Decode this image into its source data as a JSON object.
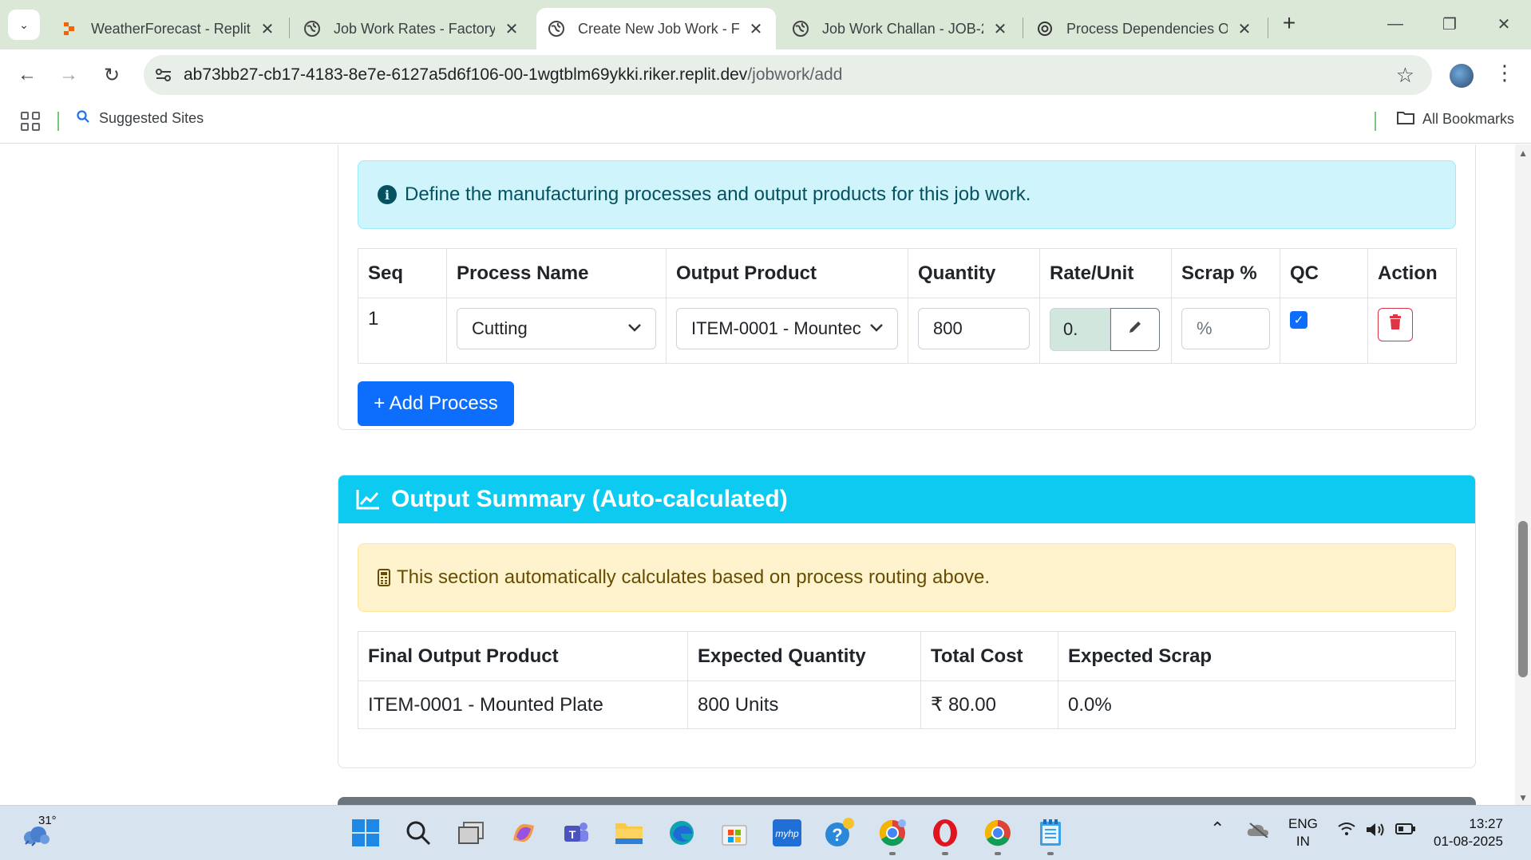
{
  "browser": {
    "tabs": [
      {
        "title": "WeatherForecast - Replit",
        "icon": "replit-icon",
        "active": false
      },
      {
        "title": "Job Work Rates - Factory",
        "icon": "globe-icon",
        "active": false
      },
      {
        "title": "Create New Job Work - F",
        "icon": "globe-icon",
        "active": true
      },
      {
        "title": "Job Work Challan - JOB-2",
        "icon": "globe-icon",
        "active": false
      },
      {
        "title": "Process Dependencies O",
        "icon": "openai-icon",
        "active": false
      }
    ],
    "url_host": "ab73bb27-cb17-4183-8e7e-6127a5d6f106-00-1wgtblm69ykki.riker.replit.dev",
    "url_path": "/jobwork/add",
    "bookmarks": {
      "suggested": "Suggested Sites",
      "all": "All Bookmarks"
    }
  },
  "process_section": {
    "info_text": "Define the manufacturing processes and output products for this job work.",
    "columns": [
      "Seq",
      "Process Name",
      "Output Product",
      "Quantity",
      "Rate/Unit",
      "Scrap %",
      "QC",
      "Action"
    ],
    "rows": [
      {
        "seq": "1",
        "process_name": "Cutting",
        "output_product": "ITEM-0001 - Mountec",
        "quantity": "800",
        "rate": "0.",
        "scrap_placeholder": "%",
        "qc_checked": true
      }
    ],
    "add_button": "+ Add Process"
  },
  "output_summary": {
    "title": "Output Summary (Auto-calculated)",
    "notice": "This section automatically calculates based on process routing above.",
    "columns": [
      "Final Output Product",
      "Expected Quantity",
      "Total Cost",
      "Expected Scrap"
    ],
    "rows": [
      {
        "product": "ITEM-0001 - Mounted Plate",
        "quantity": "800 Units",
        "cost": "₹ 80.00",
        "scrap": "0.0%"
      }
    ]
  },
  "taskbar": {
    "temperature": "31°",
    "language_line1": "ENG",
    "language_line2": "IN",
    "time": "13:27",
    "date": "01-08-2025"
  },
  "colors": {
    "primary": "#0d6efd",
    "info": "#0dcaf0",
    "danger": "#dc3545",
    "warning_bg": "#fff3cd",
    "info_bg": "#cff4fc"
  }
}
